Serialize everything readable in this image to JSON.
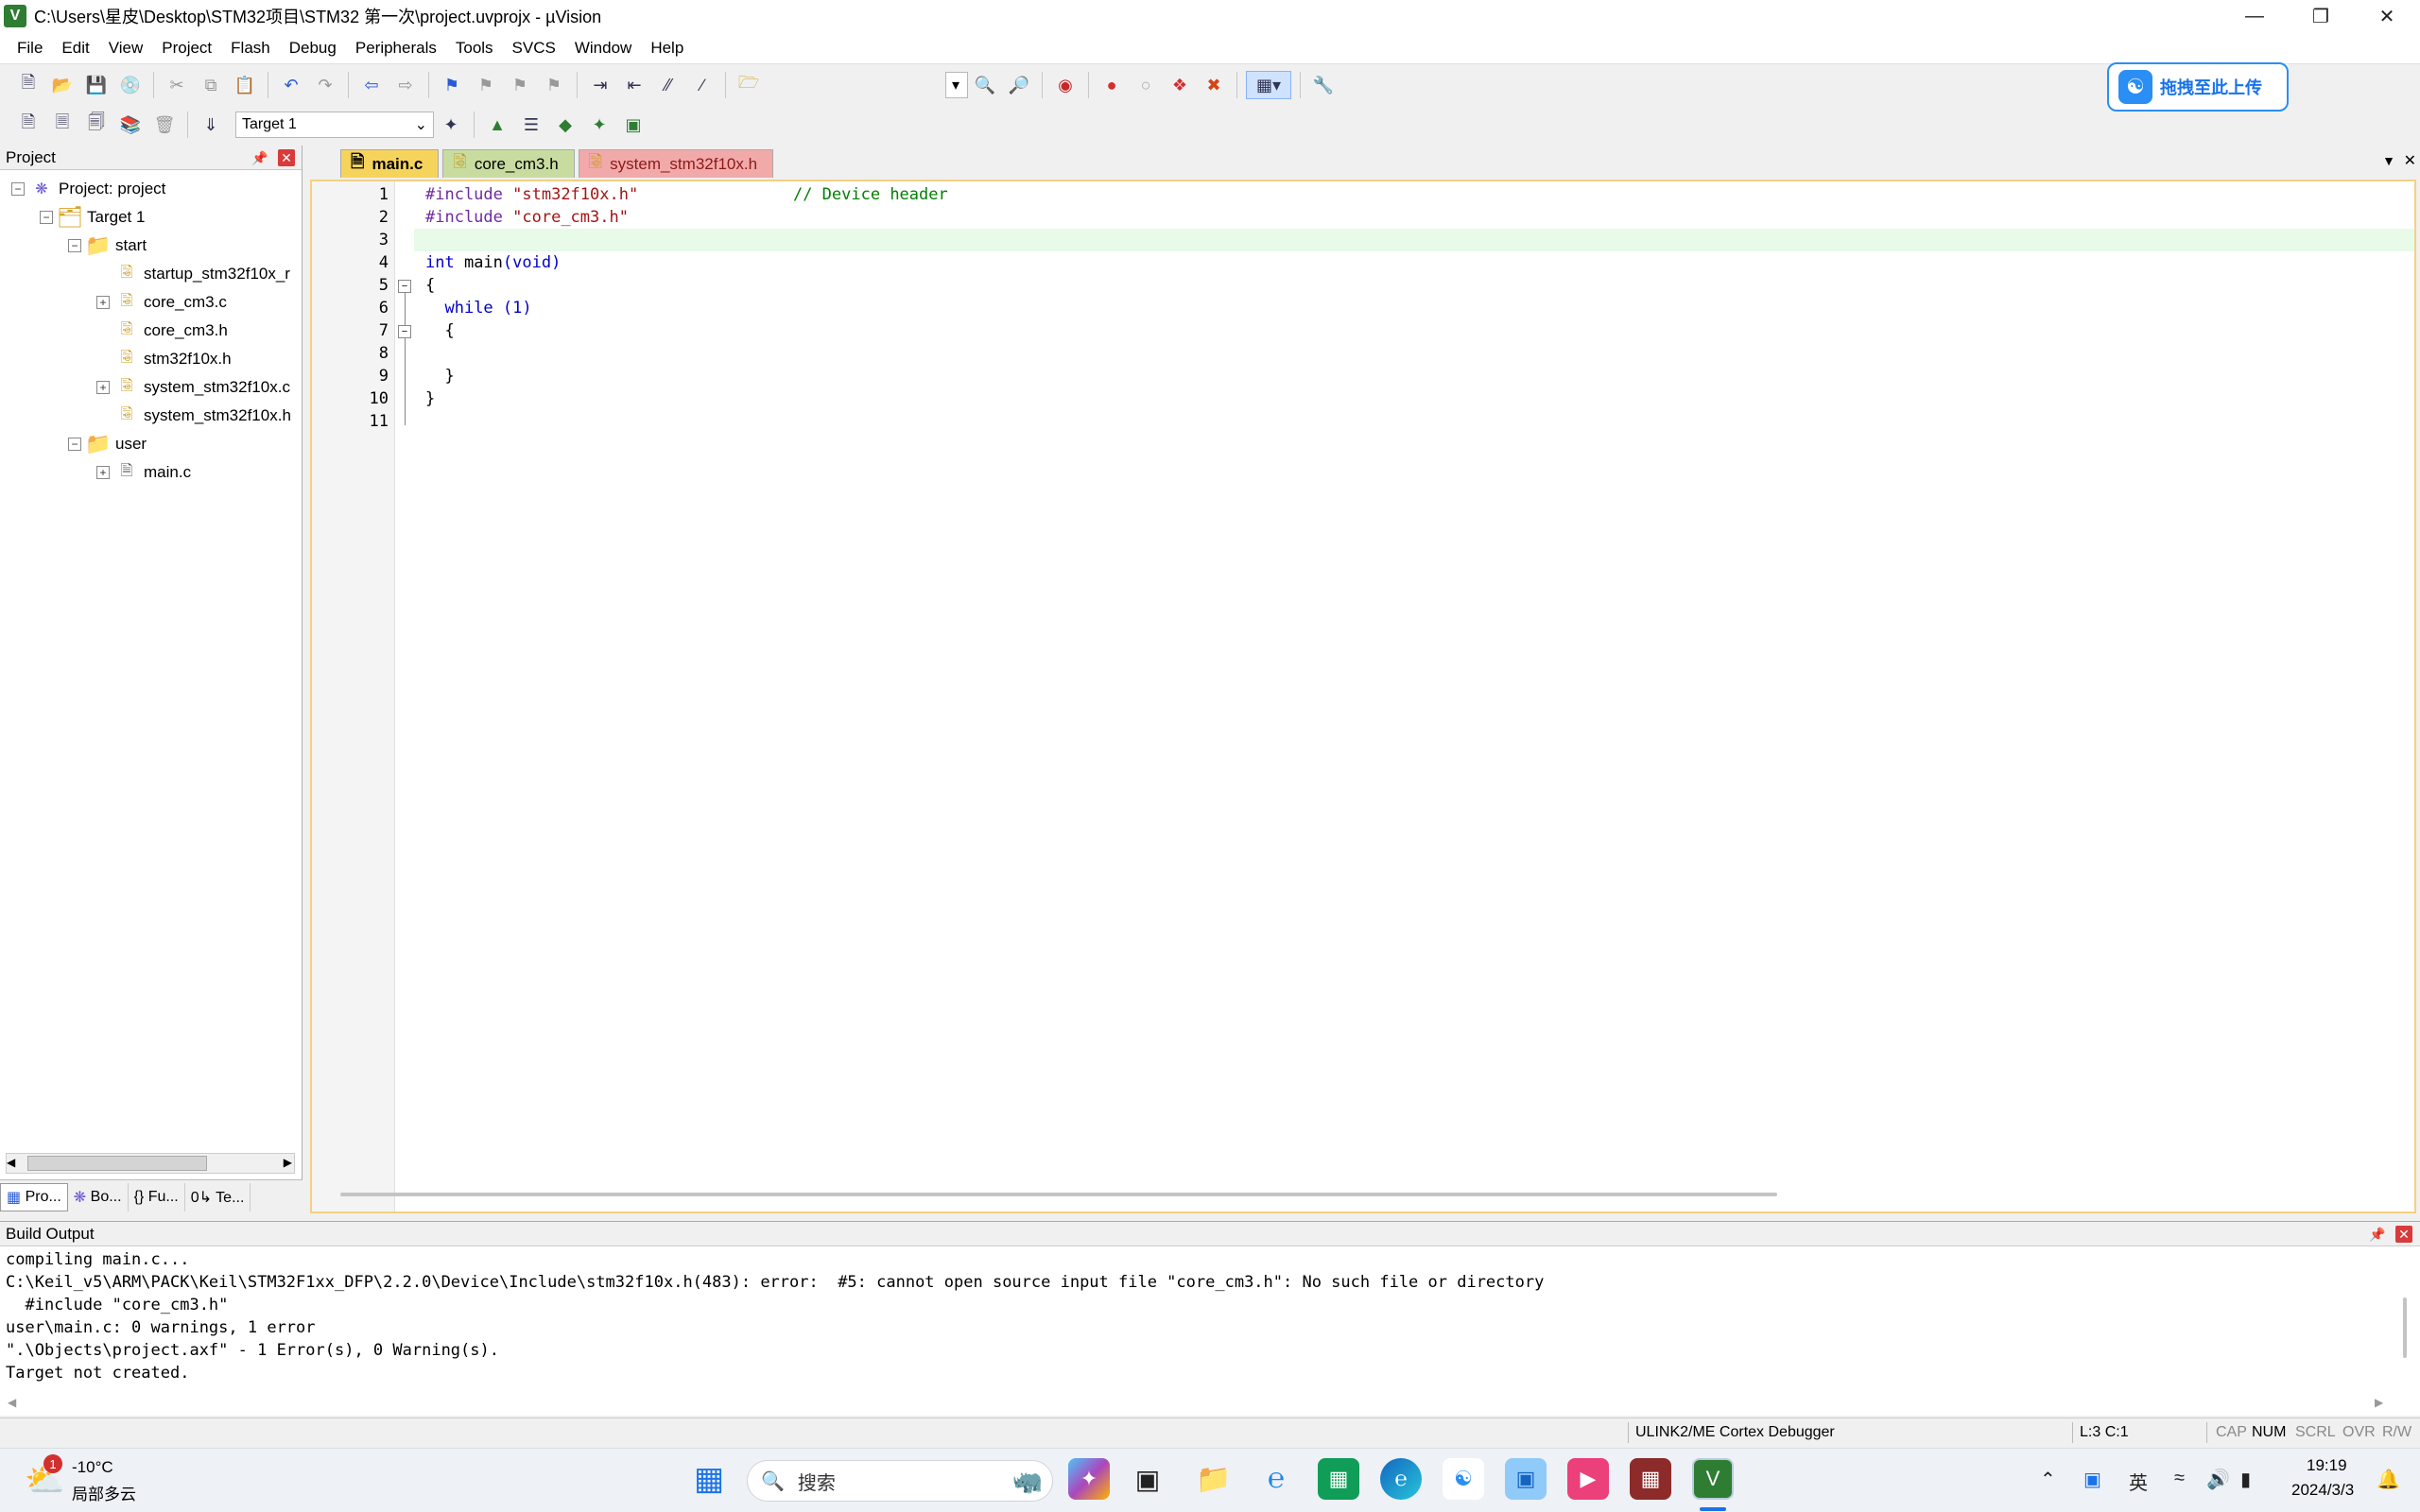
{
  "window": {
    "title": "C:\\Users\\星皮\\Desktop\\STM32项目\\STM32 第一次\\project.uvprojx - µVision",
    "app_icon": "V"
  },
  "menu": [
    "File",
    "Edit",
    "View",
    "Project",
    "Flash",
    "Debug",
    "Peripherals",
    "Tools",
    "SVCS",
    "Window",
    "Help"
  ],
  "toolbar2": {
    "target": "Target 1"
  },
  "upload_badge": {
    "label": "拖拽至此上传"
  },
  "project_panel": {
    "title": "Project",
    "tree": [
      {
        "label": "Project: project",
        "depth": 0,
        "expander": "⊟",
        "icon": "project"
      },
      {
        "label": "Target 1",
        "depth": 1,
        "expander": "⊟",
        "icon": "target"
      },
      {
        "label": "start",
        "depth": 2,
        "expander": "⊟",
        "icon": "folder"
      },
      {
        "label": "startup_stm32f10x_r",
        "depth": 3,
        "expander": "",
        "icon": "file-key"
      },
      {
        "label": "core_cm3.c",
        "depth": 3,
        "expander": "⊞",
        "icon": "file-key"
      },
      {
        "label": "core_cm3.h",
        "depth": 3,
        "expander": "",
        "icon": "file-key"
      },
      {
        "label": "stm32f10x.h",
        "depth": 3,
        "expander": "",
        "icon": "file-key"
      },
      {
        "label": "system_stm32f10x.c",
        "depth": 3,
        "expander": "⊞",
        "icon": "file-key"
      },
      {
        "label": "system_stm32f10x.h",
        "depth": 3,
        "expander": "",
        "icon": "file-key"
      },
      {
        "label": "user",
        "depth": 2,
        "expander": "⊟",
        "icon": "folder"
      },
      {
        "label": "main.c",
        "depth": 3,
        "expander": "⊞",
        "icon": "file"
      }
    ],
    "tabs": [
      "Pro...",
      "Bo...",
      "{} Fu...",
      "0↳ Te..."
    ]
  },
  "editor": {
    "tabs": [
      {
        "label": "main.c",
        "active": true,
        "color": "#f6d35b"
      },
      {
        "label": "core_cm3.h",
        "active": false,
        "color": "#c8dca0"
      },
      {
        "label": "system_stm32f10x.h",
        "active": false,
        "color": "#f2a9a9"
      }
    ],
    "line_numbers": [
      "1",
      "2",
      "3",
      "4",
      "5",
      "6",
      "7",
      "8",
      "9",
      "10",
      "11"
    ],
    "code": {
      "l1_pp": "#include",
      "l1_str": "\"stm32f10x.h\"",
      "l1_cm": "// Device header",
      "l2_pp": "#include",
      "l2_str": "\"core_cm3.h\"",
      "l4_kw": "int",
      "l4_rest": " main",
      "l4_paren": "(void)",
      "l5": "{",
      "l6_kw": "while",
      "l6_rest": " (1)",
      "l7": "{",
      "l9": "}",
      "l10": "}"
    },
    "current_line_color": "#e8fbe8"
  },
  "build_output": {
    "title": "Build Output",
    "lines": [
      "compiling main.c...",
      "C:\\Keil_v5\\ARM\\PACK\\Keil\\STM32F1xx_DFP\\2.2.0\\Device\\Include\\stm32f10x.h(483): error:  #5: cannot open source input file \"core_cm3.h\": No such file or directory",
      "  #include \"core_cm3.h\"",
      "user\\main.c: 0 warnings, 1 error",
      "\".\\Objects\\project.axf\" - 1 Error(s), 0 Warning(s).",
      "Target not created."
    ]
  },
  "status_bar": {
    "debugger": "ULINK2/ME Cortex Debugger",
    "position": "L:3 C:1",
    "cap": "CAP",
    "num": "NUM",
    "scrl": "SCRL",
    "ovr": "OVR",
    "rw": "R/W"
  },
  "taskbar": {
    "weather_temp": "-10°C",
    "weather_desc": "局部多云",
    "weather_badge": "1",
    "search_placeholder": "搜索",
    "ime": "英",
    "time": "19:19",
    "date": "2024/3/3"
  }
}
